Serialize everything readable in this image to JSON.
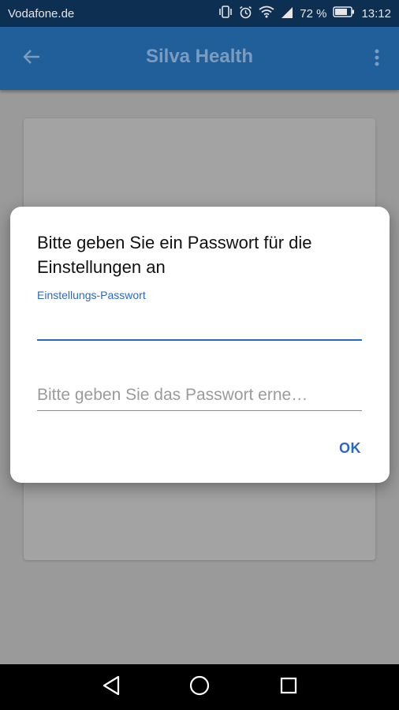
{
  "status_bar": {
    "carrier": "Vodafone.de",
    "battery_percent": "72 %",
    "time": "13:12",
    "icons": [
      "vibrate-icon",
      "alarm-icon",
      "wifi-icon",
      "signal-icon",
      "battery-icon"
    ]
  },
  "app_bar": {
    "title": "Silva Health",
    "back_icon": "arrow-back-icon",
    "menu_icon": "more-vert-icon"
  },
  "dialog": {
    "title": "Bitte geben Sie ein Passwort für die Einstellungen an",
    "password_field": {
      "label": "Einstellungs-Passwort",
      "value": ""
    },
    "confirm_field": {
      "placeholder": "Bitte geben Sie das Passwort erne…",
      "value": ""
    },
    "ok_label": "OK"
  },
  "nav_bar": {
    "back_icon": "nav-back-icon",
    "home_icon": "nav-home-icon",
    "recents_icon": "nav-recents-icon"
  },
  "colors": {
    "status_bar": "#0c2f52",
    "app_bar": "#215f9a",
    "accent": "#2a68c8",
    "scrim": "#9a9a9a"
  }
}
